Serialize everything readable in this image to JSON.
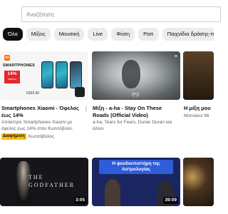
{
  "search": {
    "placeholder": "Αναζήτηση"
  },
  "chips": [
    "Όλα",
    "Μίξεις",
    "Μουσική",
    "Live",
    "Φύση",
    "Ραπ",
    "Παιχνίδια δράσης-περιπέτειας"
  ],
  "videos": [
    {
      "title": "Smartphones Xiaomi - Όφελος έως 14%",
      "description": "Απόκτησε Smartphones Xiaomi με όφελος έως 14% στον Κωτσόβολο.",
      "badge": "Διαφήμιση",
      "channel": "Κωτσόβολος",
      "thumb": {
        "logo": "mi",
        "brand": "SMARTPHONES",
        "discount": "14%",
        "discount_note": "όφελος",
        "price": "€369.90"
      }
    },
    {
      "title": "Μίξη - a-ha - Stay On These Roads (Official Video)",
      "channel": "a-ha, Tears for Fears, Duran Duran και άλλοι"
    },
    {
      "title": "Η μίξη μου",
      "channel": "Monsieur Mi"
    },
    {
      "thumb_text": "THE\nGODFATHER",
      "duration": "3:05"
    },
    {
      "thumb_text": "Η ψευδοεπιστήμη της Αστρολογίας",
      "duration": "39:09"
    },
    {}
  ],
  "colors": {
    "chip_active": "#0f0f0f",
    "chip_inactive": "#ececec",
    "ad_badge": "#fbbf1c",
    "discount": "#e4262f",
    "astro_banner": "#2f5cd8"
  }
}
